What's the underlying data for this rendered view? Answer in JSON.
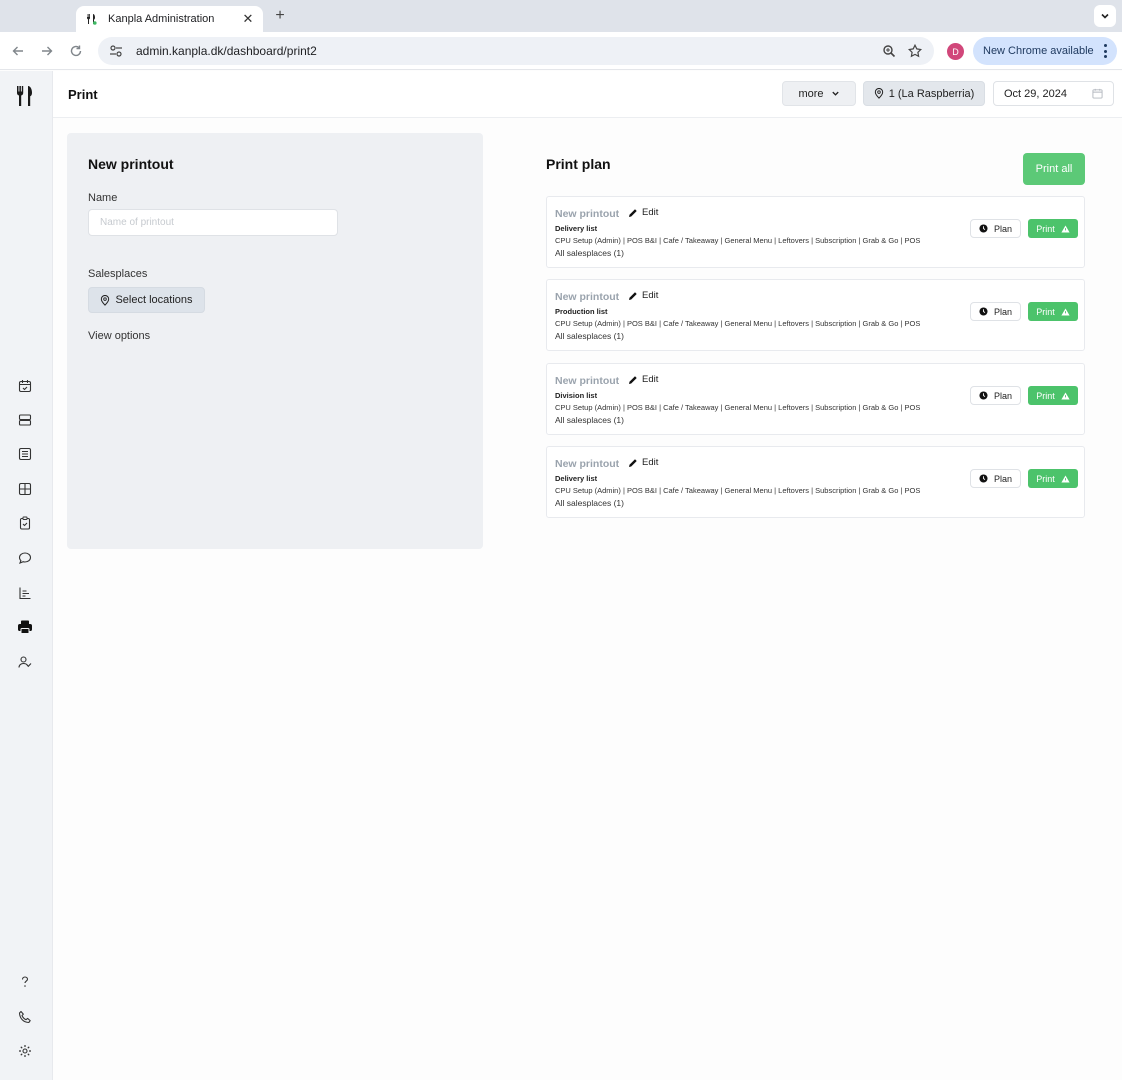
{
  "browser": {
    "tab_title": "Kanpla Administration",
    "url": "admin.kanpla.dk/dashboard/print2",
    "profile_initial": "D",
    "update_label": "New Chrome available"
  },
  "header": {
    "title": "Print",
    "more_label": "more",
    "location_label": "1 (La Raspberria)",
    "date_value": "Oct 29, 2024"
  },
  "new_printout": {
    "title": "New printout",
    "name_label": "Name",
    "name_value": "",
    "name_placeholder": "Name of printout",
    "salesplaces_label": "Salesplaces",
    "select_locations_label": "Select locations",
    "view_options_label": "View options"
  },
  "print_plan": {
    "title": "Print plan",
    "print_all_label": "Print all",
    "edit_label": "Edit",
    "plan_label": "Plan",
    "print_label": "Print",
    "items": [
      {
        "name": "New printout",
        "type": "Delivery list",
        "menus": "CPU Setup (Admin) | POS B&I | Cafe / Takeaway | General Menu | Leftovers | Subscription | Grab & Go | POS",
        "salesplaces": "All salesplaces (1)"
      },
      {
        "name": "New printout",
        "type": "Production list",
        "menus": "CPU Setup (Admin) | POS B&I | Cafe / Takeaway | General Menu | Leftovers | Subscription | Grab & Go | POS",
        "salesplaces": "All salesplaces (1)"
      },
      {
        "name": "New printout",
        "type": "Division list",
        "menus": "CPU Setup (Admin) | POS B&I | Cafe / Takeaway | General Menu | Leftovers | Subscription | Grab & Go | POS",
        "salesplaces": "All salesplaces (1)"
      },
      {
        "name": "New printout",
        "type": "Delivery list",
        "menus": "CPU Setup (Admin) | POS B&I | Cafe / Takeaway | General Menu | Leftovers | Subscription | Grab & Go | POS",
        "salesplaces": "All salesplaces (1)"
      }
    ]
  },
  "sidebar": {
    "logo_icon": "fork-knife-icon",
    "icons": [
      "calendar-icon",
      "server-icon",
      "list-icon",
      "grid-icon",
      "clipboard-icon",
      "chat-icon",
      "bar-chart-icon",
      "printer-icon",
      "user-check-icon"
    ],
    "bottom_icons": [
      "help-icon",
      "phone-icon",
      "gear-icon"
    ]
  },
  "colors": {
    "accent_green": "#4cc36b",
    "sidebar_bg": "#f1f3f6",
    "panel_bg": "#eef0f3"
  }
}
